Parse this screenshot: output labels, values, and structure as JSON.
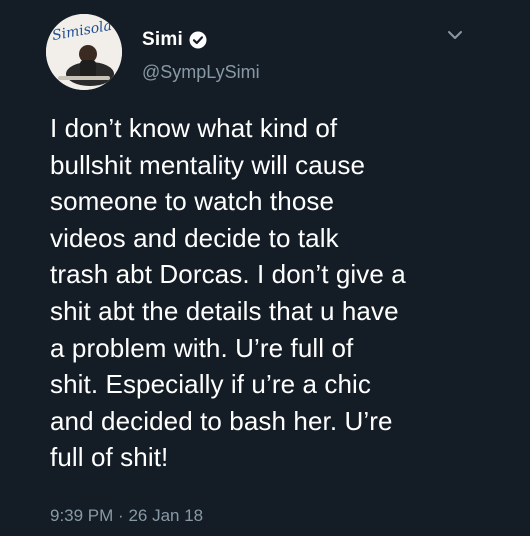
{
  "author": {
    "display_name": "Simi",
    "handle": "@SympLySimi",
    "verified": true,
    "avatar_logo_text": "Simisola"
  },
  "tweet": {
    "lines": [
      "I don’t know what kind of",
      "bullshit mentality will cause",
      "someone to watch those",
      "videos and decide to talk",
      "trash abt Dorcas. I don’t give a",
      "shit abt the details that u have",
      "a problem with. U’re full of",
      "shit. Especially if u’re a chic",
      "and decided to bash her. U’re",
      "full of shit!"
    ],
    "time": "9:39 PM",
    "separator": "·",
    "date": "26 Jan 18"
  },
  "icons": {
    "verified": "verified-badge-icon",
    "menu": "chevron-down-icon"
  },
  "colors": {
    "background": "#141d26",
    "text": "#ffffff",
    "secondary": "#8899a6"
  }
}
